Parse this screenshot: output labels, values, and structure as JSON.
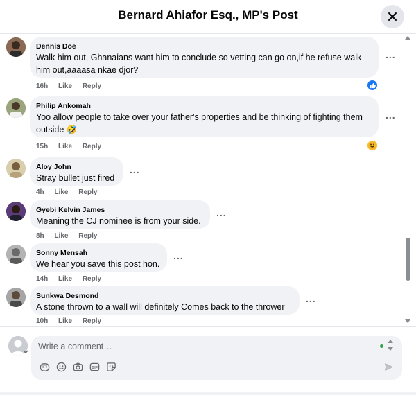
{
  "header": {
    "title": "Bernard Ahiafor Esq., MP's Post"
  },
  "icons": {
    "close": "close-icon",
    "like_reaction": "like-reaction-icon",
    "haha_reaction": "haha-reaction-icon",
    "more": "more-options-icon"
  },
  "colors": {
    "like_blue": "#1877f2",
    "haha_yellow": "#f7b928",
    "bubble": "#f0f2f5",
    "meta_text": "#65676b"
  },
  "comments": [
    {
      "author": "Dennis Doe",
      "text": "Walk him out, Ghanaians want him to conclude so vetting can go on,if he refuse walk him out,aaaasa nkae djor?",
      "time": "16h",
      "like": "Like",
      "reply": "Reply",
      "more": "...",
      "reaction": "like"
    },
    {
      "author": "Philip Ankomah",
      "text": "Yoo allow people to take over your father's properties and be thinking of fighting them outside 🤣",
      "time": "15h",
      "like": "Like",
      "reply": "Reply",
      "more": "...",
      "reaction": "haha"
    },
    {
      "author": "Aloy John",
      "text": "Stray bullet just fired",
      "time": "4h",
      "like": "Like",
      "reply": "Reply",
      "more": "..."
    },
    {
      "author": "Gyebi Kelvin James",
      "text": "Meaning the CJ nominee is from your side.",
      "time": "8h",
      "like": "Like",
      "reply": "Reply",
      "more": "..."
    },
    {
      "author": "Sonny Mensah",
      "text": "We hear you save this post hon.",
      "time": "14h",
      "like": "Like",
      "reply": "Reply",
      "more": "..."
    },
    {
      "author": "Sunkwa Desmond",
      "text": "A stone thrown to a wall will definitely Comes back to the thrower",
      "time": "10h",
      "like": "Like",
      "reply": "Reply",
      "more": "..."
    }
  ],
  "composer": {
    "placeholder": "Write a comment…",
    "value": "",
    "tools": [
      "avatar-sticker-icon",
      "emoji-icon",
      "camera-icon",
      "gif-icon",
      "sticker-icon"
    ],
    "send": "send-icon"
  }
}
